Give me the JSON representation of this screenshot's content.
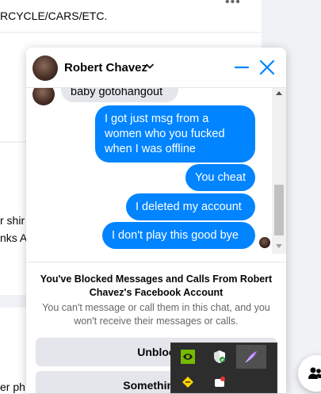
{
  "background": {
    "top_text": "RCYCLE/CARS/ETC.",
    "left_text_1": "r shir",
    "left_text_2": "nks A",
    "bottom_left_text": "er ph"
  },
  "chat": {
    "contact_name": "Robert Chavez",
    "messages": [
      {
        "from": "them",
        "text": "baby gotohangout"
      },
      {
        "from": "me",
        "text": "I got just msg from a women who you fucked when I was offline"
      },
      {
        "from": "me",
        "text": "You cheat"
      },
      {
        "from": "me",
        "text": "I deleted my account"
      },
      {
        "from": "me",
        "text": "I don't play this good bye"
      }
    ],
    "blocked_title": "You've Blocked Messages and Calls From Robert Chavez's Facebook Account",
    "blocked_description": "You can't message or call them in this chat, and you won't receive their messages or calls.",
    "unblock_label": "Unbloc",
    "something_label": "Something's"
  },
  "icons": {
    "header_dropdown": "chevron-down-icon",
    "minimize": "minimize-icon",
    "close": "close-icon",
    "tray_nvidia": "nvidia-icon",
    "tray_defender": "shield-icon",
    "tray_feather": "feather-icon",
    "tray_yellow": "yellow-diamond-icon",
    "tray_red": "red-icon",
    "new_message": "people-icon"
  },
  "colors": {
    "accent": "#0084ff",
    "outgoing_bubble": "#0084ff",
    "incoming_bubble": "#e4e6eb",
    "button_bg": "#e4e6eb"
  }
}
